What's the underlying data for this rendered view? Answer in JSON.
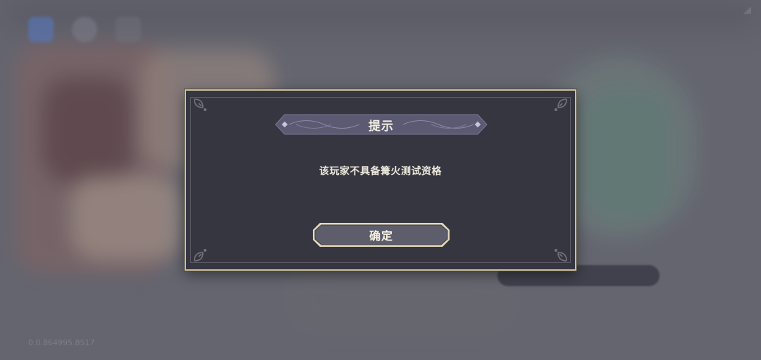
{
  "dialog": {
    "title": "提示",
    "message": "该玩家不具备篝火测试资格",
    "confirm_label": "确定"
  },
  "background": {
    "version_text": "0.0.864995.8517",
    "top_icons": [
      "menu-icon",
      "settings-icon",
      "info-icon"
    ]
  },
  "colors": {
    "dialog_bg": "#363640",
    "dialog_border": "#cdbf9a",
    "banner_fill": "#5a5870",
    "button_fill": "#5c5b68",
    "button_border": "#e2d6b2"
  }
}
